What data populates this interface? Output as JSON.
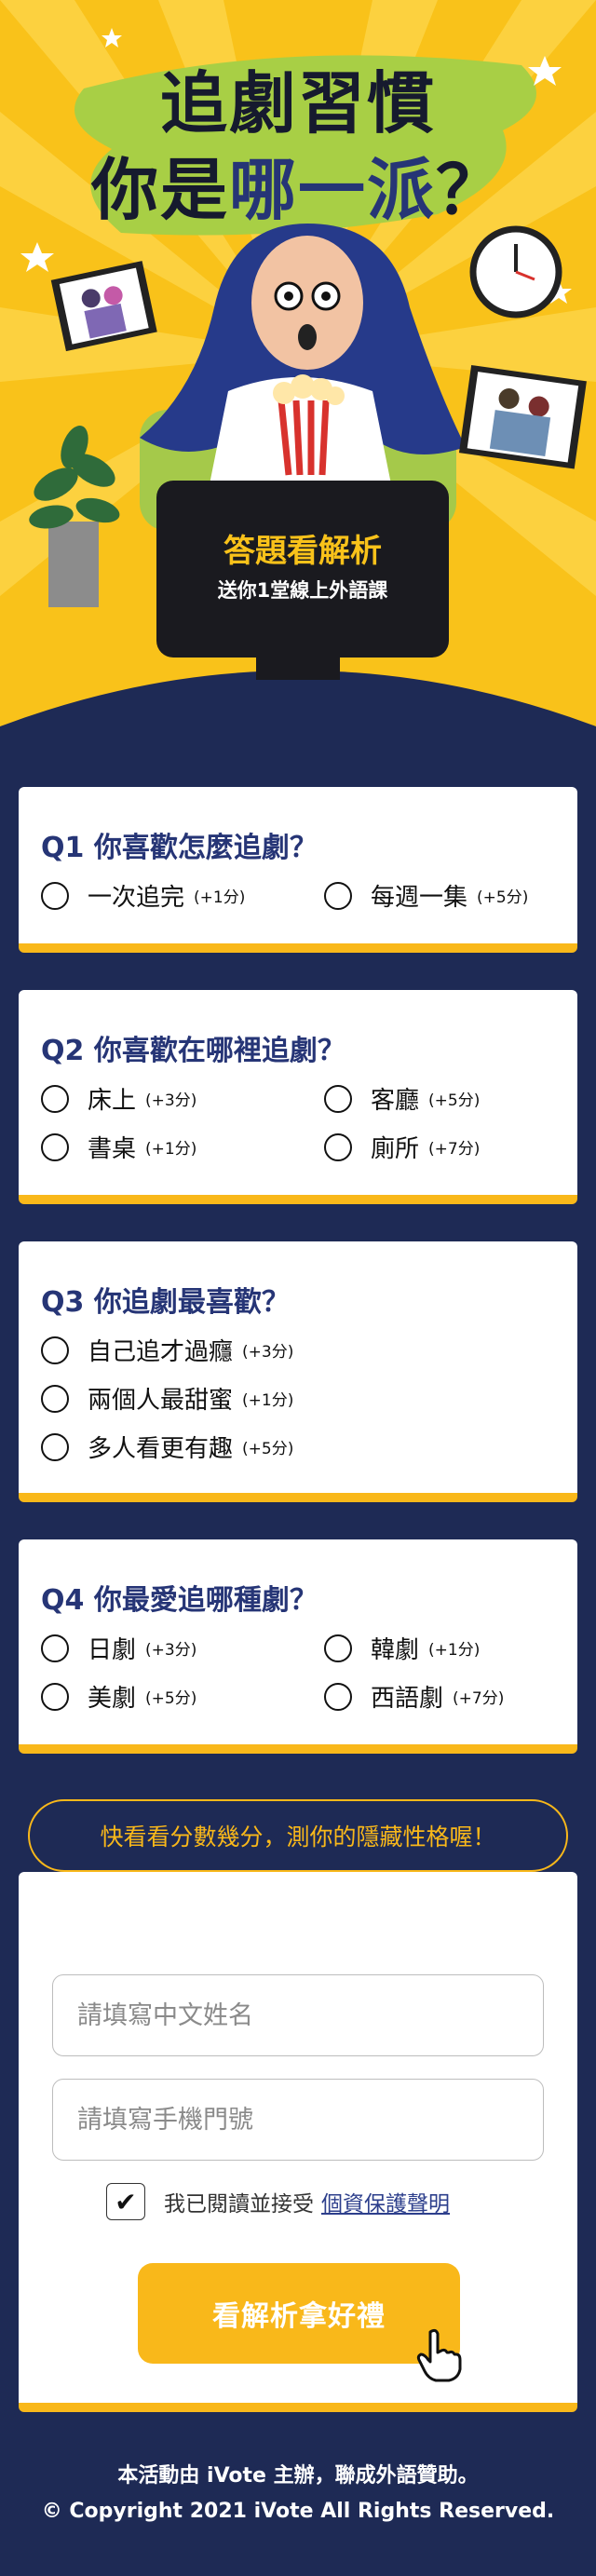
{
  "hero": {
    "title_line1": "追劇習慣",
    "title_line2_pre": "你是",
    "title_line2_accent": "哪一派",
    "title_line2_q": "？",
    "tv_heading": "答題看解析",
    "tv_sub": "送你1堂線上外語課"
  },
  "questions": [
    {
      "title": "Q1 你喜歡怎麼追劇？",
      "options": [
        {
          "label": "一次追完",
          "points": "(+1分)"
        },
        {
          "label": "每週一集",
          "points": "(+5分)"
        }
      ]
    },
    {
      "title": "Q2 你喜歡在哪裡追劇？",
      "options": [
        {
          "label": "床上",
          "points": "(+3分)"
        },
        {
          "label": "客廳",
          "points": "(+5分)"
        },
        {
          "label": "書桌",
          "points": "(+1分)"
        },
        {
          "label": "廁所",
          "points": "(+7分)"
        }
      ]
    },
    {
      "title": "Q3 你追劇最喜歡？",
      "options": [
        {
          "label": "自己追才過癮",
          "points": "(+3分)"
        },
        {
          "label": "兩個人最甜蜜",
          "points": "(+1分)"
        },
        {
          "label": "多人看更有趣",
          "points": "(+5分)"
        }
      ]
    },
    {
      "title": "Q4 你最愛追哪種劇？",
      "options": [
        {
          "label": "日劇",
          "points": "(+3分)"
        },
        {
          "label": "韓劇",
          "points": "(+1分)"
        },
        {
          "label": "美劇",
          "points": "(+5分)"
        },
        {
          "label": "西語劇",
          "points": "(+7分)"
        }
      ]
    }
  ],
  "banner": "快看看分數幾分，測你的隱藏性格喔！",
  "form": {
    "name_placeholder": "請填寫中文姓名",
    "phone_placeholder": "請填寫手機門號",
    "consent_text": "我已閱讀並接受",
    "consent_link": "個資保護聲明",
    "consent_checked": true,
    "submit_label": "看解析拿好禮"
  },
  "footer": {
    "line1": "本活動由 iVote 主辦，聯成外語贊助。",
    "line2": "© Copyright 2021 iVote All Rights Reserved."
  },
  "colors": {
    "navy": "#1e2a55",
    "yellow": "#f9c21a",
    "accent_yellow": "#f9b81a",
    "title_blue": "#263576"
  },
  "icons": [
    "radio-icon",
    "checkmark-icon",
    "pointer-hand-icon",
    "clock-icon",
    "popcorn-icon"
  ]
}
